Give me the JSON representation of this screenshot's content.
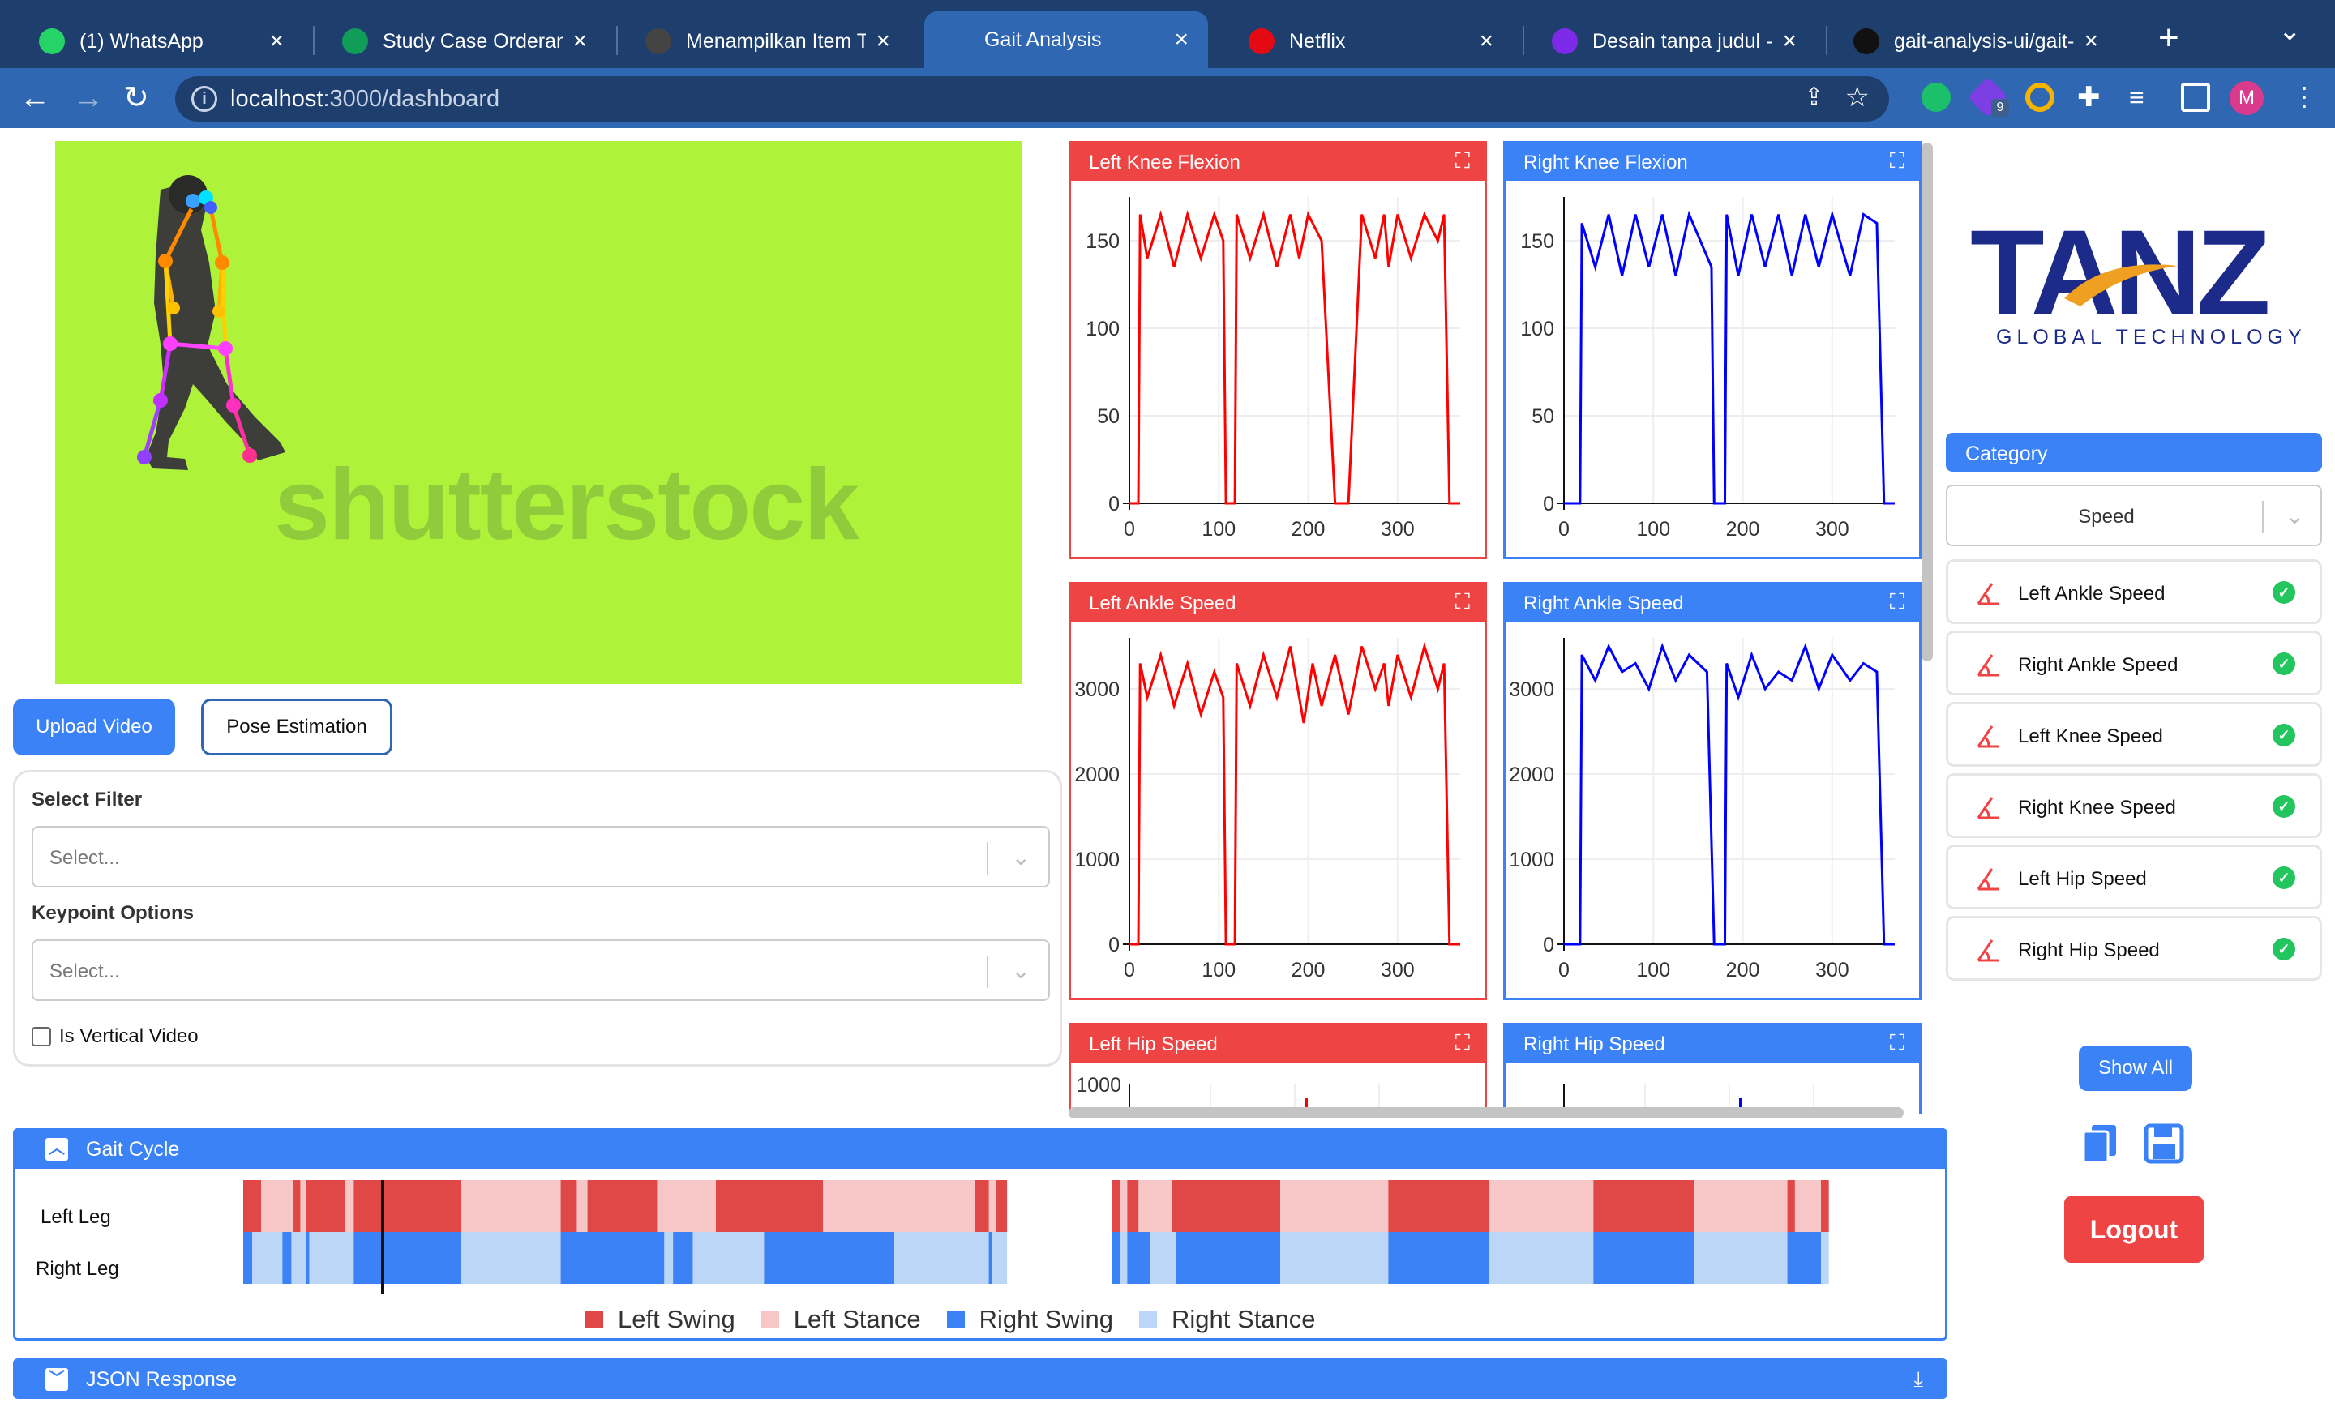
{
  "browser": {
    "tabs": [
      {
        "title": "(1) WhatsApp",
        "icon": "whatsapp-icon",
        "color": "#25d366"
      },
      {
        "title": "Study Case Orderan E",
        "icon": "sheets-icon",
        "color": "#0f9d58"
      },
      {
        "title": "Menampilkan Item To",
        "icon": "g-icon",
        "color": "#444444"
      },
      {
        "title": "Gait Analysis",
        "icon": "react-icon",
        "color": "#2f67b3"
      },
      {
        "title": "Netflix",
        "icon": "netflix-icon",
        "color": "#e50914"
      },
      {
        "title": "Desain tanpa judul - F",
        "icon": "canva-icon",
        "color": "#7d2ae8"
      },
      {
        "title": "gait-analysis-ui/gait-",
        "icon": "github-icon",
        "color": "#111111"
      }
    ],
    "url_host": "localhost",
    "url_path": ":3000/dashboard",
    "extension_badge": "9",
    "profile_initial": "M"
  },
  "video": {
    "watermark": "shutterstock"
  },
  "buttons": {
    "upload": "Upload Video",
    "pose": "Pose Estimation"
  },
  "filters": {
    "select_filter_label": "Select Filter",
    "select_filter_placeholder": "Select...",
    "keypoint_label": "Keypoint Options",
    "keypoint_placeholder": "Select...",
    "vertical_label": "Is Vertical Video"
  },
  "charts": [
    {
      "title": "Left Knee Flexion",
      "color": "#ef4444",
      "line": "#ff0000",
      "yticks": [
        "150",
        "100",
        "50",
        "0"
      ],
      "xticks": [
        "0",
        "100",
        "200",
        "300"
      ]
    },
    {
      "title": "Right Knee Flexion",
      "color": "#3b82f6",
      "line": "#0000ff",
      "yticks": [
        "150",
        "100",
        "50",
        "0"
      ],
      "xticks": [
        "0",
        "100",
        "200",
        "300"
      ]
    },
    {
      "title": "Left Ankle Speed",
      "color": "#ef4444",
      "line": "#ff0000",
      "yticks": [
        "3000",
        "2000",
        "1000",
        "0"
      ],
      "xticks": [
        "0",
        "100",
        "200",
        "300"
      ]
    },
    {
      "title": "Right Ankle Speed",
      "color": "#3b82f6",
      "line": "#0000ff",
      "yticks": [
        "3000",
        "2000",
        "1000",
        "0"
      ],
      "xticks": [
        "0",
        "100",
        "200",
        "300"
      ]
    },
    {
      "title": "Left Hip Speed",
      "color": "#ef4444",
      "line": "#ff0000",
      "yticks": [
        "1000"
      ],
      "xticks": []
    },
    {
      "title": "Right Hip Speed",
      "color": "#3b82f6",
      "line": "#0000ff",
      "yticks": [],
      "xticks": []
    }
  ],
  "logo": {
    "brand": "TANZ",
    "tagline": "GLOBAL TECHNOLOGY"
  },
  "category": {
    "header": "Category",
    "selected": "Speed",
    "items": [
      "Left Ankle Speed",
      "Right Ankle Speed",
      "Left Knee Speed",
      "Right Knee Speed",
      "Left Hip Speed",
      "Right Hip Speed"
    ]
  },
  "actions": {
    "show_all": "Show All",
    "logout": "Logout"
  },
  "gait": {
    "title": "Gait Cycle",
    "left_leg": "Left Leg",
    "right_leg": "Right Leg",
    "legend": [
      {
        "label": "Left Swing",
        "color": "#e04848"
      },
      {
        "label": "Left Stance",
        "color": "#f7c6c6"
      },
      {
        "label": "Right Swing",
        "color": "#3b82f6"
      },
      {
        "label": "Right Stance",
        "color": "#bcd6f7"
      }
    ]
  },
  "json_panel": {
    "title": "JSON Response"
  },
  "chart_data": [
    {
      "type": "line",
      "title": "Left Knee Flexion",
      "xlim": [
        0,
        370
      ],
      "ylim": [
        0,
        175
      ],
      "x": [
        0,
        10,
        12,
        20,
        35,
        50,
        65,
        80,
        95,
        105,
        108,
        118,
        120,
        135,
        150,
        165,
        180,
        190,
        200,
        215,
        230,
        245,
        260,
        275,
        285,
        290,
        300,
        315,
        330,
        345,
        352,
        358,
        370
      ],
      "y": [
        0,
        0,
        165,
        140,
        165,
        135,
        165,
        140,
        165,
        150,
        0,
        0,
        165,
        140,
        165,
        135,
        165,
        140,
        165,
        150,
        0,
        0,
        165,
        140,
        165,
        135,
        165,
        140,
        165,
        150,
        165,
        0,
        0
      ]
    },
    {
      "type": "line",
      "title": "Right Knee Flexion",
      "xlim": [
        0,
        370
      ],
      "ylim": [
        0,
        175
      ],
      "x": [
        0,
        18,
        20,
        35,
        50,
        65,
        80,
        95,
        110,
        125,
        140,
        165,
        168,
        180,
        182,
        195,
        210,
        225,
        240,
        255,
        270,
        285,
        300,
        320,
        335,
        350,
        358,
        370
      ],
      "y": [
        0,
        0,
        160,
        135,
        165,
        130,
        165,
        135,
        165,
        130,
        165,
        135,
        0,
        0,
        165,
        130,
        165,
        135,
        165,
        130,
        165,
        135,
        165,
        130,
        165,
        160,
        0,
        0
      ]
    },
    {
      "type": "line",
      "title": "Left Ankle Speed",
      "xlim": [
        0,
        370
      ],
      "ylim": [
        0,
        3600
      ],
      "x": [
        0,
        10,
        12,
        20,
        35,
        50,
        65,
        80,
        95,
        105,
        108,
        118,
        120,
        135,
        150,
        165,
        180,
        195,
        205,
        215,
        230,
        245,
        260,
        275,
        285,
        290,
        300,
        315,
        330,
        345,
        352,
        358,
        370
      ],
      "y": [
        0,
        0,
        3300,
        2900,
        3400,
        2800,
        3300,
        2700,
        3200,
        2900,
        0,
        0,
        3300,
        2800,
        3400,
        2900,
        3500,
        2600,
        3300,
        2800,
        3400,
        2700,
        3500,
        3000,
        3300,
        2800,
        3400,
        2900,
        3500,
        3000,
        3300,
        0,
        0
      ]
    },
    {
      "type": "line",
      "title": "Right Ankle Speed",
      "xlim": [
        0,
        370
      ],
      "ylim": [
        0,
        3600
      ],
      "x": [
        0,
        18,
        20,
        35,
        50,
        65,
        80,
        95,
        110,
        125,
        140,
        160,
        168,
        180,
        182,
        195,
        210,
        225,
        240,
        255,
        270,
        285,
        300,
        320,
        335,
        350,
        358,
        370
      ],
      "y": [
        0,
        0,
        3400,
        3100,
        3500,
        3200,
        3300,
        3000,
        3500,
        3100,
        3400,
        3200,
        0,
        0,
        3300,
        2900,
        3400,
        3000,
        3200,
        3100,
        3500,
        3000,
        3400,
        3100,
        3300,
        3200,
        0,
        0
      ]
    }
  ]
}
